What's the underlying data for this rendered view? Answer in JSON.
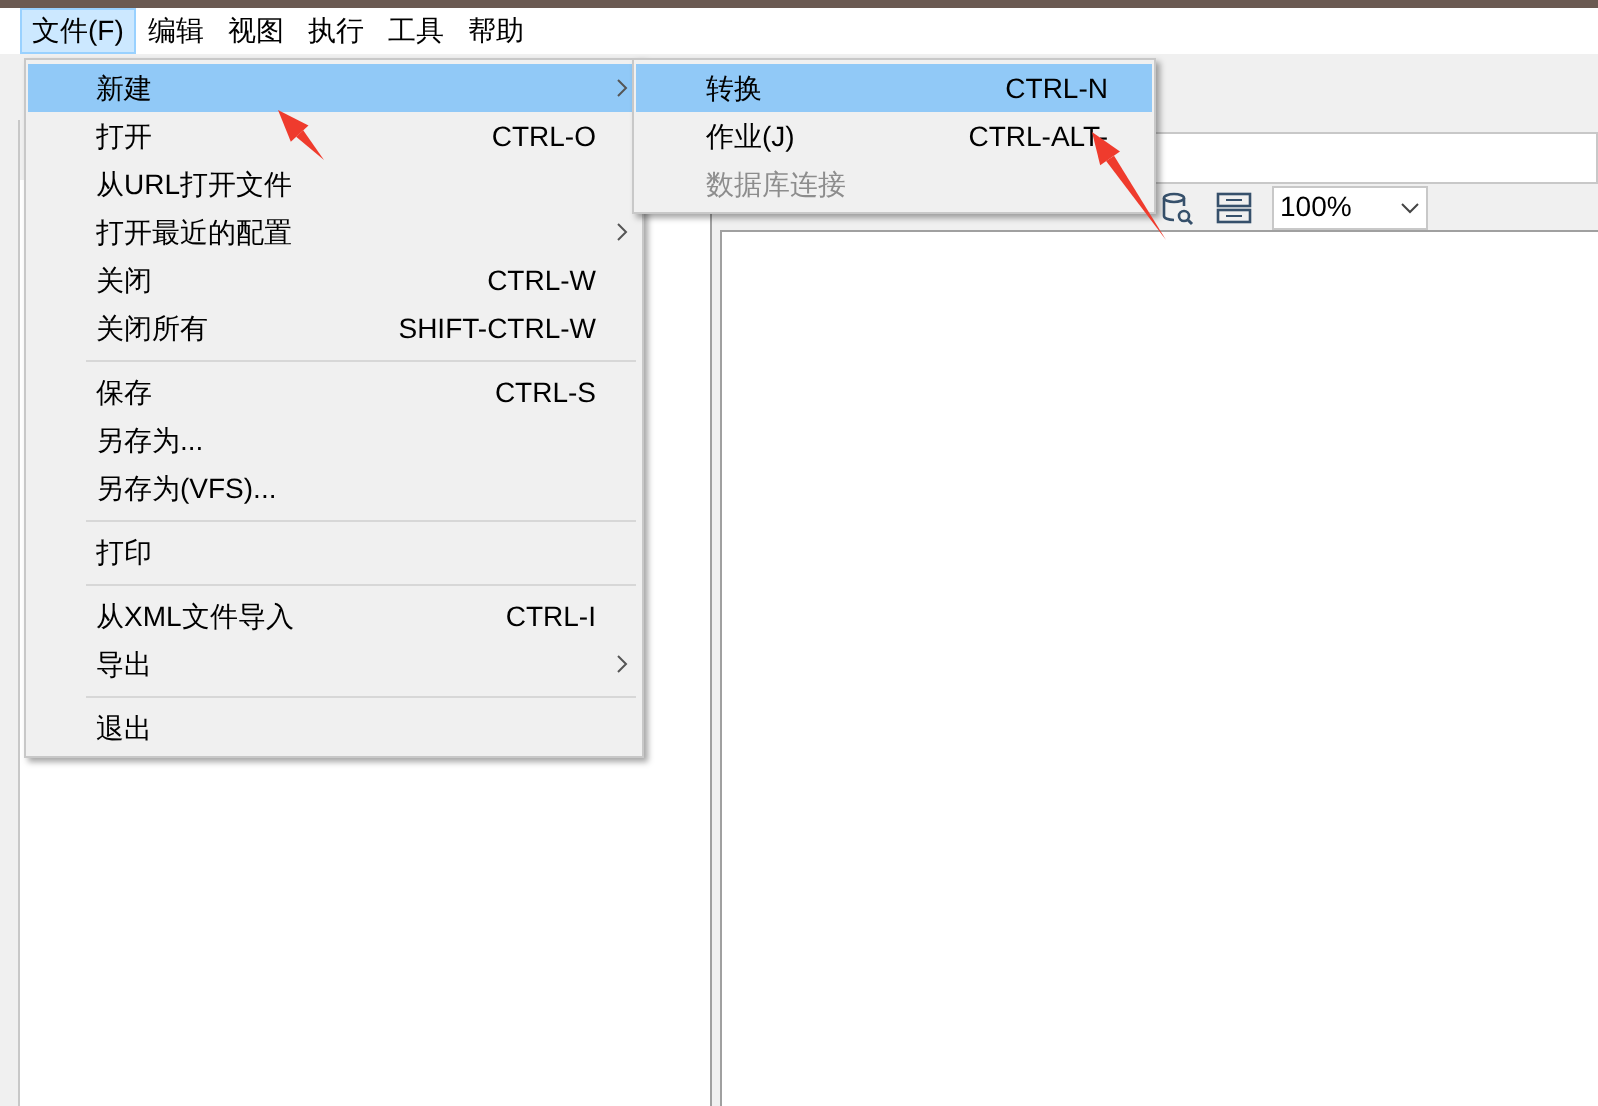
{
  "menubar": [
    {
      "label": "文件(F)",
      "selected": true
    },
    {
      "label": "编辑",
      "selected": false
    },
    {
      "label": "视图",
      "selected": false
    },
    {
      "label": "执行",
      "selected": false
    },
    {
      "label": "工具",
      "selected": false
    },
    {
      "label": "帮助",
      "selected": false
    }
  ],
  "file_menu": [
    {
      "kind": "item",
      "label": "新建",
      "submenu": true,
      "selected": true
    },
    {
      "kind": "item",
      "label": "打开",
      "shortcut": "CTRL-O",
      "selected": false
    },
    {
      "kind": "item",
      "label": "从URL打开文件",
      "selected": false
    },
    {
      "kind": "item",
      "label": "打开最近的配置",
      "submenu": true,
      "selected": false
    },
    {
      "kind": "item",
      "label": "关闭",
      "shortcut": "CTRL-W",
      "selected": false
    },
    {
      "kind": "item",
      "label": "关闭所有",
      "shortcut": "SHIFT-CTRL-W",
      "selected": false
    },
    {
      "kind": "separator"
    },
    {
      "kind": "item",
      "label": "保存",
      "shortcut": "CTRL-S",
      "selected": false
    },
    {
      "kind": "item",
      "label": "另存为...",
      "selected": false
    },
    {
      "kind": "item",
      "label": "另存为(VFS)...",
      "selected": false
    },
    {
      "kind": "separator"
    },
    {
      "kind": "item",
      "label": "打印",
      "selected": false
    },
    {
      "kind": "separator"
    },
    {
      "kind": "item",
      "label": "从XML文件导入",
      "shortcut": "CTRL-I",
      "selected": false
    },
    {
      "kind": "item",
      "label": "导出",
      "submenu": true,
      "selected": false
    },
    {
      "kind": "separator"
    },
    {
      "kind": "item",
      "label": "退出",
      "selected": false
    }
  ],
  "new_submenu": [
    {
      "label": "转换",
      "shortcut": "CTRL-N",
      "selected": true,
      "disabled": false
    },
    {
      "label": "作业(J)",
      "shortcut": "CTRL-ALT-",
      "selected": false,
      "disabled": false
    },
    {
      "label": "数据库连接",
      "selected": false,
      "disabled": true
    }
  ],
  "toolbar": {
    "zoom": "100%"
  }
}
